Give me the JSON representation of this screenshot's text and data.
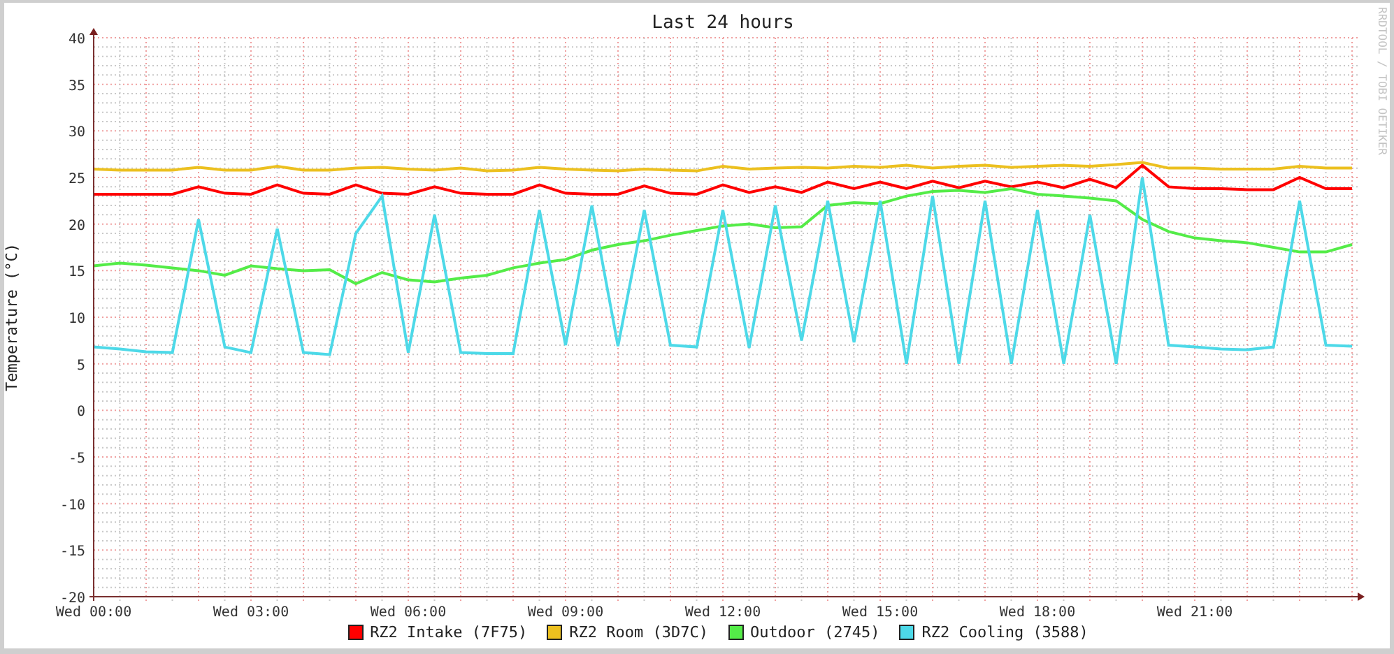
{
  "chart_data": {
    "type": "line",
    "grid": true,
    "title": "Last 24 hours",
    "ylabel": "Temperature (°C)",
    "categories": [
      "Wed 00:00",
      null,
      null,
      null,
      null,
      null,
      "Wed 03:00",
      null,
      null,
      null,
      null,
      null,
      "Wed 06:00",
      null,
      null,
      null,
      null,
      null,
      "Wed 09:00",
      null,
      null,
      null,
      null,
      null,
      "Wed 12:00",
      null,
      null,
      null,
      null,
      null,
      "Wed 15:00",
      null,
      null,
      null,
      null,
      null,
      "Wed 18:00",
      null,
      null,
      null,
      null,
      null,
      "Wed 21:00",
      null,
      null,
      null,
      null,
      null,
      null
    ],
    "ylim": [
      -20,
      40
    ],
    "yticks": [
      -20,
      -15,
      -10,
      -5,
      0,
      5,
      10,
      15,
      20,
      25,
      30,
      35,
      40
    ],
    "series": [
      {
        "name": "RZ2 Intake (7F75)",
        "color": "#ff0000",
        "values": [
          23.2,
          23.2,
          23.2,
          23.2,
          24.0,
          23.3,
          23.2,
          24.2,
          23.3,
          23.2,
          24.2,
          23.3,
          23.2,
          24.0,
          23.3,
          23.2,
          23.2,
          24.2,
          23.3,
          23.2,
          23.2,
          24.1,
          23.3,
          23.2,
          24.2,
          23.4,
          24.0,
          23.4,
          24.5,
          23.8,
          24.5,
          23.8,
          24.6,
          23.9,
          24.6,
          24.0,
          24.5,
          23.9,
          24.8,
          23.9,
          26.3,
          24.0,
          23.8,
          23.8,
          23.7,
          23.7,
          25.0,
          23.8,
          23.8
        ]
      },
      {
        "name": "RZ2 Room (3D7C)",
        "color": "#ecc01f",
        "values": [
          25.9,
          25.8,
          25.8,
          25.8,
          26.1,
          25.8,
          25.8,
          26.2,
          25.8,
          25.8,
          26.0,
          26.1,
          25.9,
          25.8,
          26.0,
          25.7,
          25.8,
          26.1,
          25.9,
          25.8,
          25.7,
          25.9,
          25.8,
          25.7,
          26.2,
          25.9,
          26.0,
          26.1,
          26.0,
          26.2,
          26.1,
          26.3,
          26.0,
          26.2,
          26.3,
          26.1,
          26.2,
          26.3,
          26.2,
          26.4,
          26.6,
          26.0,
          26.0,
          25.9,
          25.9,
          25.9,
          26.2,
          26.0,
          26.0
        ]
      },
      {
        "name": "Outdoor (2745)",
        "color": "#54ec48",
        "values": [
          15.5,
          15.8,
          15.6,
          15.3,
          15.0,
          14.5,
          15.5,
          15.2,
          15.0,
          15.1,
          13.6,
          14.8,
          14.0,
          13.8,
          14.2,
          14.5,
          15.3,
          15.8,
          16.2,
          17.2,
          17.8,
          18.2,
          18.8,
          19.3,
          19.8,
          20.0,
          19.6,
          19.7,
          22.0,
          22.3,
          22.2,
          23.0,
          23.5,
          23.6,
          23.4,
          23.8,
          23.2,
          23.0,
          22.8,
          22.5,
          20.5,
          19.2,
          18.5,
          18.2,
          18.0,
          17.5,
          17.0,
          17.0,
          17.8
        ]
      },
      {
        "name": "RZ2 Cooling (3588)",
        "color": "#4dd9e8",
        "values": [
          6.8,
          6.6,
          6.3,
          6.2,
          20.5,
          6.8,
          6.2,
          19.5,
          6.2,
          6.0,
          19.0,
          23.0,
          6.2,
          21.0,
          6.2,
          6.1,
          6.1,
          21.5,
          7.0,
          22.0,
          6.9,
          21.5,
          7.0,
          6.8,
          21.5,
          6.7,
          22.0,
          7.5,
          22.5,
          7.3,
          22.5,
          5.0,
          23.0,
          5.0,
          22.5,
          5.0,
          21.5,
          5.0,
          21.0,
          5.0,
          25.0,
          7.0,
          6.8,
          6.6,
          6.5,
          6.8,
          22.5,
          7.0,
          6.9
        ]
      }
    ]
  },
  "credit": "RRDTOOL / TOBI OETIKER"
}
